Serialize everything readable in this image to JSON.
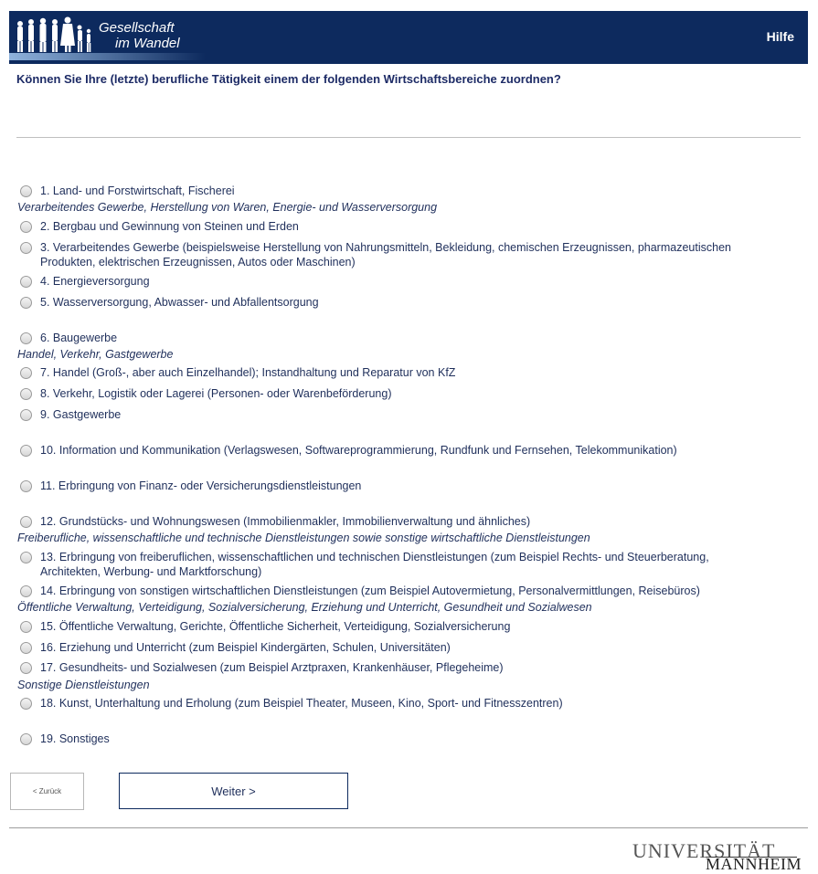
{
  "header": {
    "logo_line1": "Gesellschaft",
    "logo_line2": "im Wandel",
    "help": "Hilfe"
  },
  "question": "Können Sie Ihre (letzte) berufliche Tätigkeit einem der folgenden Wirtschaftsbereiche zuordnen?",
  "groups": {
    "g1": "Verarbeitendes Gewerbe, Herstellung von Waren, Energie- und Wasserversorgung",
    "g2": "Handel, Verkehr, Gastgewerbe",
    "g3": "Freiberufliche, wissenschaftliche und technische Dienstleistungen sowie sonstige wirtschaftliche Dienstleistungen",
    "g4": "Öffentliche Verwaltung, Verteidigung, Sozialversicherung, Erziehung und Unterricht, Gesundheit und Sozialwesen",
    "g5": "Sonstige Dienstleistungen"
  },
  "options": [
    "1. Land- und Forstwirtschaft, Fischerei",
    "2. Bergbau und Gewinnung von Steinen und Erden",
    "3. Verarbeitendes Gewerbe (beispielsweise Herstellung von Nahrungsmitteln, Bekleidung, chemischen Erzeugnissen, pharmazeutischen Produkten, elektrischen Erzeugnissen, Autos oder Maschinen)",
    "4. Energieversorgung",
    "5. Wasserversorgung, Abwasser- und Abfallentsorgung",
    "6. Baugewerbe",
    "7. Handel (Groß-, aber auch Einzelhandel); Instandhaltung und Reparatur von KfZ",
    "8. Verkehr, Logistik oder Lagerei (Personen- oder Warenbeförderung)",
    "9. Gastgewerbe",
    "10. Information und Kommunikation (Verlagswesen, Softwareprogrammierung, Rundfunk und Fernsehen, Telekommunikation)",
    "11. Erbringung von Finanz- oder Versicherungsdienstleistungen",
    "12. Grundstücks- und Wohnungswesen (Immobilienmakler, Immobilienverwaltung und ähnliches)",
    "13. Erbringung von freiberuflichen, wissenschaftlichen und technischen Dienstleistungen (zum Beispiel Rechts- und Steuerberatung, Architekten, Werbung- und Marktforschung)",
    "14. Erbringung von sonstigen wirtschaftlichen Dienstleistungen (zum Beispiel Autovermietung, Personalvermittlungen, Reisebüros)",
    "15. Öffentliche Verwaltung, Gerichte, Öffentliche Sicherheit, Verteidigung, Sozialversicherung",
    "16. Erziehung und Unterricht (zum Beispiel Kindergärten, Schulen, Universitäten)",
    "17. Gesundheits- und Sozialwesen (zum Beispiel Arztpraxen, Krankenhäuser, Pflegeheime)",
    "18. Kunst, Unterhaltung und Erholung (zum Beispiel Theater, Museen, Kino, Sport- und Fitnesszentren)",
    "19. Sonstiges"
  ],
  "buttons": {
    "back": "< Zurück",
    "next": "Weiter >"
  },
  "footer": {
    "uni_line1": "UNIVERSITÄT",
    "uni_line2": "MANNHEIM"
  }
}
